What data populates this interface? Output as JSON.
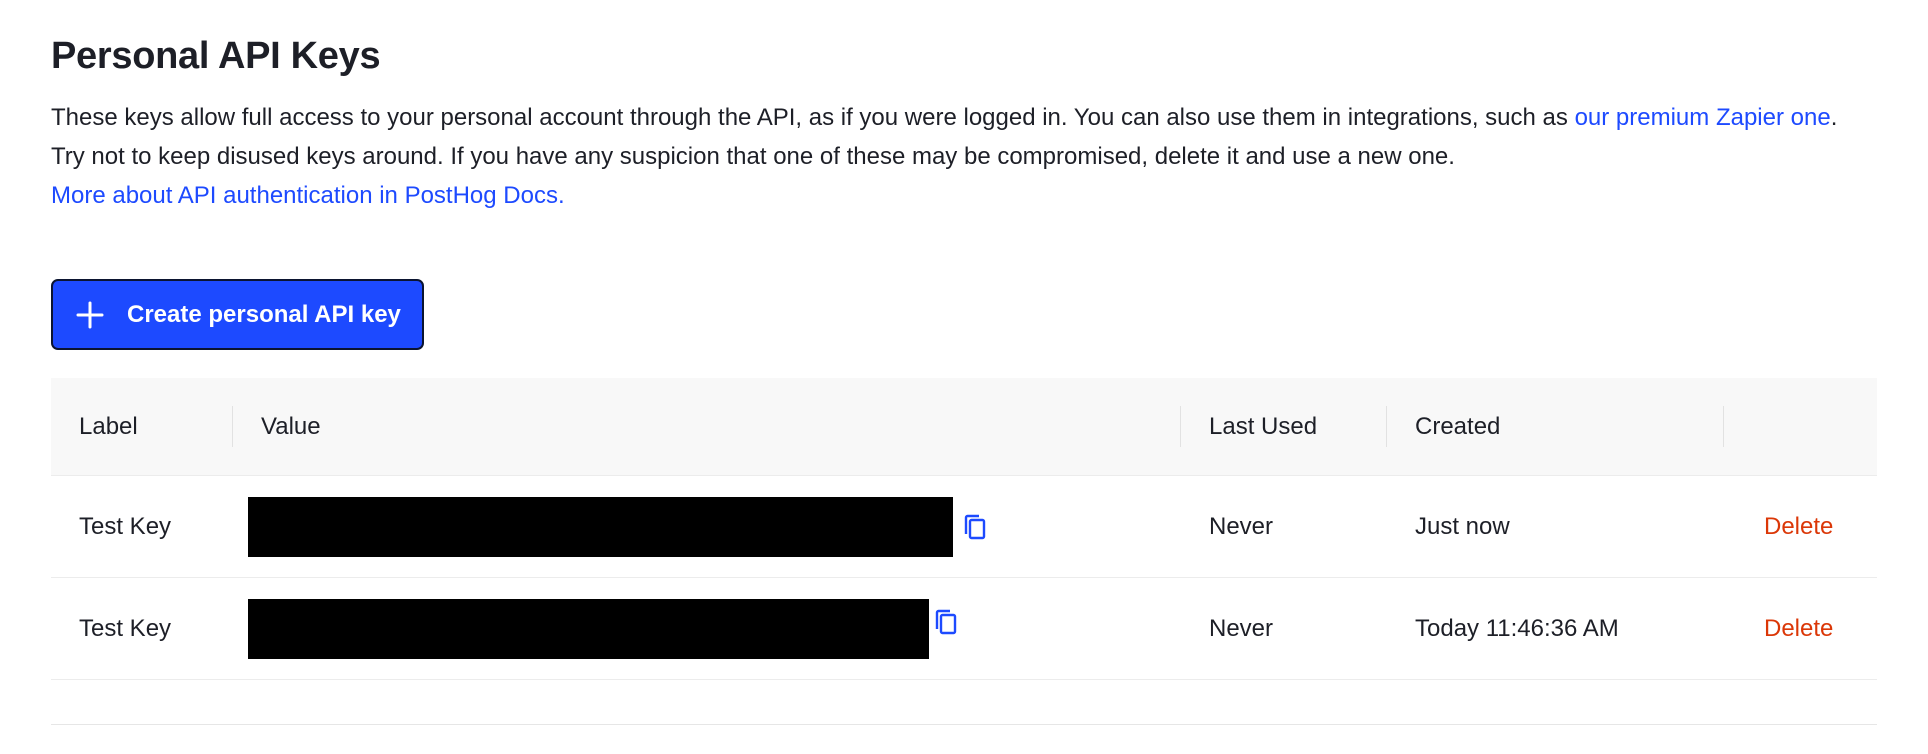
{
  "page": {
    "title": "Personal API Keys",
    "description_line1": "These keys allow full access to your personal account through the API, as if you were logged in. You can also use them in integrations, such as ",
    "zapier_link": "our premium Zapier one",
    "description_line1_end": ".",
    "description_line2": "Try not to keep disused keys around. If you have any suspicion that one of these may be compromised, delete it and use a new one.",
    "docs_link": "More about API authentication in PostHog Docs."
  },
  "actions": {
    "create_label": "Create personal API key",
    "create_icon": "plus-icon"
  },
  "table": {
    "columns": {
      "label": "Label",
      "value": "Value",
      "last_used": "Last Used",
      "created": "Created"
    },
    "rows": [
      {
        "label": "Test Key",
        "last_used": "Never",
        "created": "Just now",
        "action": "Delete"
      },
      {
        "label": "Test Key",
        "last_used": "Never",
        "created": "Today 11:46:36 AM",
        "action": "Delete"
      }
    ]
  },
  "colors": {
    "primary": "#1d4aff",
    "danger": "#db3707",
    "text": "#1d1f27",
    "header_bg": "#f8f8f8"
  }
}
